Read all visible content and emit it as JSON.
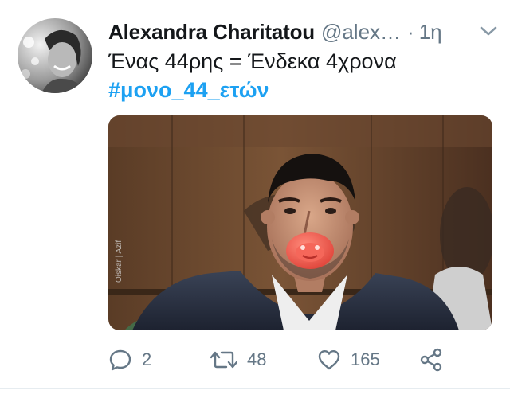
{
  "tweet": {
    "author": {
      "display_name": "Alexandra Charitatou",
      "handle": "@alex…",
      "avatar_icon": "profile-photo"
    },
    "separator": "·",
    "time": "1η",
    "text": "Ένας 44ρης = Ένδεκα 4χρονα",
    "hashtag": "#μονο_44_ετών",
    "media": {
      "type": "photo",
      "credit": "Oiskar | Azif"
    },
    "actions": {
      "reply": {
        "icon": "reply-icon",
        "count": "2"
      },
      "retweet": {
        "icon": "retweet-icon",
        "count": "48"
      },
      "like": {
        "icon": "heart-icon",
        "count": "165"
      },
      "share": {
        "icon": "share-icon"
      }
    }
  },
  "colors": {
    "text_primary": "#14171a",
    "text_secondary": "#657786",
    "link": "#1da1f2"
  }
}
